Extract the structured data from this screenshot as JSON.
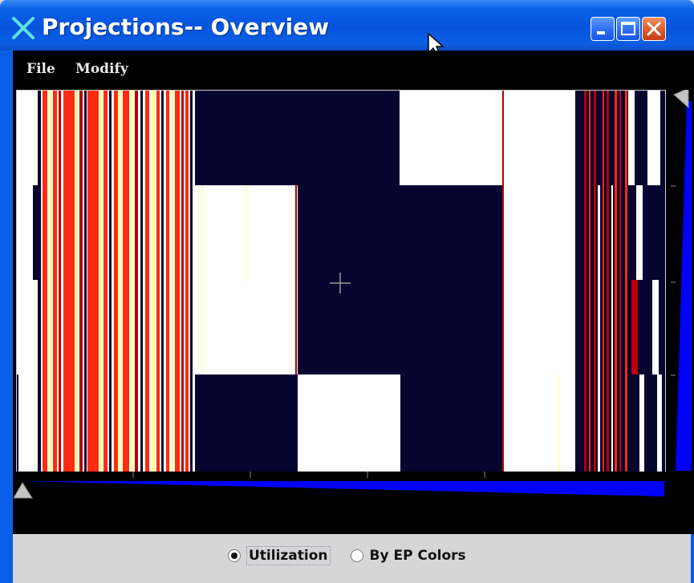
{
  "window": {
    "title": "Projections-- Overview",
    "titlebar_color": "#0a5fe6",
    "controls": [
      "minimize-icon",
      "maximize-icon",
      "close-icon"
    ]
  },
  "menu": {
    "items": [
      {
        "label": "File"
      },
      {
        "label": "Modify"
      }
    ]
  },
  "overview": {
    "colors": {
      "idle": "#050530",
      "busy": "#ffffff",
      "high": "#ff2a10",
      "mid": "#b80000",
      "low": "#ffff90",
      "scroll_track": "#0000ff"
    }
  },
  "view_mode": {
    "options": [
      {
        "label": "Utilization",
        "selected": true
      },
      {
        "label": "By EP Colors",
        "selected": false
      }
    ]
  }
}
